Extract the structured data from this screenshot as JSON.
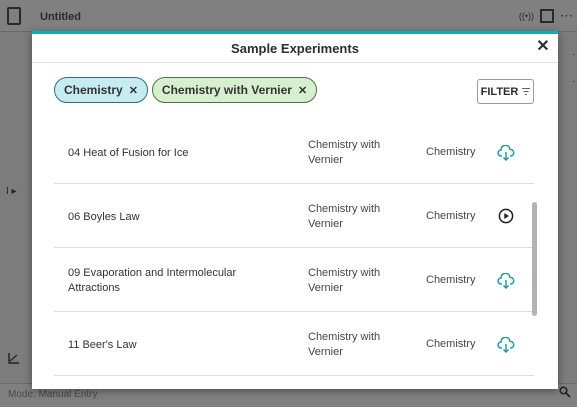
{
  "app": {
    "title": "Untitled",
    "mode_label": "Mode: Manual Entry"
  },
  "modal": {
    "title": "Sample Experiments",
    "close_glyph": "✕"
  },
  "filters": {
    "chips": [
      {
        "label": "Chemistry",
        "color": "#c6ecf3"
      },
      {
        "label": "Chemistry with Vernier",
        "color": "#d6efcf"
      }
    ],
    "remove_glyph": "✕",
    "filter_button_label": "FILTER"
  },
  "experiments": [
    {
      "name": "04 Heat of Fusion for Ice",
      "source": "Chemistry with Vernier",
      "subject": "Chemistry",
      "action_icon": "cloud-download-icon"
    },
    {
      "name": "06 Boyles Law",
      "source": "Chemistry with Vernier",
      "subject": "Chemistry",
      "action_icon": "play-circle-icon"
    },
    {
      "name": "09 Evaporation and Intermolecular Attractions",
      "source": "Chemistry with Vernier",
      "subject": "Chemistry",
      "action_icon": "cloud-download-icon"
    },
    {
      "name": "11 Beer's Law",
      "source": "Chemistry with Vernier",
      "subject": "Chemistry",
      "action_icon": "cloud-download-icon"
    }
  ],
  "colors": {
    "accent": "#0bb0b0",
    "icon_teal": "#1a9aa0"
  }
}
